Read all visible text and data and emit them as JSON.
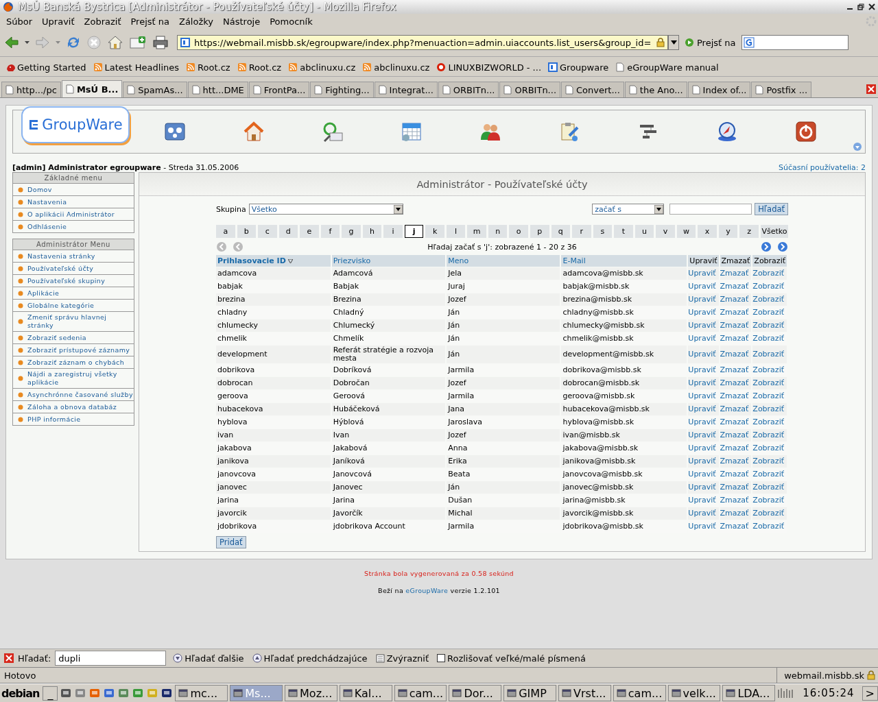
{
  "window": {
    "title": "MsÚ Banská Bystrica [Administrátor - Používateľské účty] - Mozilla Firefox"
  },
  "menu": [
    "Súbor",
    "Upraviť",
    "Zobraziť",
    "Prejsť na",
    "Záložky",
    "Nástroje",
    "Pomocník"
  ],
  "address": {
    "value": "https://webmail.misbb.sk/egroupware/index.php?menuaction=admin.uiaccounts.list_users&group_id=",
    "go": "Prejsť na"
  },
  "bookmarks": [
    {
      "label": "Getting Started",
      "kind": "page"
    },
    {
      "label": "Latest Headlines",
      "kind": "feed"
    },
    {
      "label": "Root.cz",
      "kind": "feed"
    },
    {
      "label": "Root.cz",
      "kind": "feed"
    },
    {
      "label": "abclinuxu.cz",
      "kind": "feed"
    },
    {
      "label": "abclinuxu.cz",
      "kind": "feed"
    },
    {
      "label": "LINUXBIZWORLD - ...",
      "kind": "ring"
    },
    {
      "label": "Groupware",
      "kind": "egw"
    },
    {
      "label": "eGroupWare manual",
      "kind": "doc"
    }
  ],
  "tabs": [
    {
      "label": "http.../pc",
      "selected": false
    },
    {
      "label": "MsÚ B...",
      "selected": true
    },
    {
      "label": "SpamAs...",
      "selected": false
    },
    {
      "label": "htt...DME",
      "selected": false
    },
    {
      "label": "FrontPa...",
      "selected": false
    },
    {
      "label": "Fighting...",
      "selected": false
    },
    {
      "label": "Integrat...",
      "selected": false
    },
    {
      "label": "ORBITn...",
      "selected": false
    },
    {
      "label": "ORBITn...",
      "selected": false
    },
    {
      "label": "Convert...",
      "selected": false
    },
    {
      "label": "the Ano...",
      "selected": false
    },
    {
      "label": "Index of...",
      "selected": false
    },
    {
      "label": "Postfix ...",
      "selected": false
    }
  ],
  "logo": "GroupWare",
  "user_line": {
    "user": "[admin] Administrator egroupware",
    "date": " - Streda 31.05.2006",
    "online": "Súčasní používatelia: 2"
  },
  "sidebar": [
    {
      "title": "Základné menu",
      "items": [
        "Domov",
        "Nastavenia",
        "O aplikácii Administrátor",
        "Odhlásenie"
      ]
    },
    {
      "title": "Administrátor Menu",
      "items": [
        "Nastavenia stránky",
        "Používateľské účty",
        "Používateľské skupiny",
        "Aplikácie",
        "Globálne kategórie",
        "Zmeniť správu hlavnej stránky",
        "Zobraziť sedenia",
        "Zobraziť prístupové záznamy",
        "Zobraziť záznam o chybách",
        "Nájdi a zaregistruj všetky aplikácie",
        "Asynchrónne časované služby",
        "Záloha a obnova databáz",
        "PHP informácie"
      ]
    }
  ],
  "panel_title": "Administrátor - Používateľské účty",
  "filter": {
    "group_label": "Skupina",
    "group_value": "Všetko",
    "mode_value": "začať s",
    "search_button": "Hľadať"
  },
  "letters": [
    {
      "label": "a",
      "selected": false
    },
    {
      "label": "b",
      "selected": false
    },
    {
      "label": "c",
      "selected": false
    },
    {
      "label": "d",
      "selected": false
    },
    {
      "label": "e",
      "selected": false
    },
    {
      "label": "f",
      "selected": false
    },
    {
      "label": "g",
      "selected": false
    },
    {
      "label": "h",
      "selected": false
    },
    {
      "label": "i",
      "selected": false
    },
    {
      "label": "j",
      "selected": true
    },
    {
      "label": "k",
      "selected": false
    },
    {
      "label": "l",
      "selected": false
    },
    {
      "label": "m",
      "selected": false
    },
    {
      "label": "n",
      "selected": false
    },
    {
      "label": "o",
      "selected": false
    },
    {
      "label": "p",
      "selected": false
    },
    {
      "label": "q",
      "selected": false
    },
    {
      "label": "r",
      "selected": false
    },
    {
      "label": "s",
      "selected": false
    },
    {
      "label": "t",
      "selected": false
    },
    {
      "label": "u",
      "selected": false
    },
    {
      "label": "v",
      "selected": false
    },
    {
      "label": "w",
      "selected": false
    },
    {
      "label": "x",
      "selected": false
    },
    {
      "label": "y",
      "selected": false
    },
    {
      "label": "z",
      "selected": false
    },
    {
      "label": "Všetko",
      "selected": false
    }
  ],
  "result_info": "Hľadaj začať s 'j': zobrazené 1 - 20 z 36",
  "table": {
    "columns": [
      {
        "label": "Prihlasovacie ID",
        "sorted": true,
        "kind": "link"
      },
      {
        "label": "Priezvisko",
        "sorted": false,
        "kind": "link"
      },
      {
        "label": "Meno",
        "sorted": false,
        "kind": "link"
      },
      {
        "label": "E-Mail",
        "sorted": false,
        "kind": "link"
      },
      {
        "label": "Upraviť",
        "sorted": false,
        "kind": "plain"
      },
      {
        "label": "Zmazať",
        "sorted": false,
        "kind": "plain"
      },
      {
        "label": "Zobraziť",
        "sorted": false,
        "kind": "plain"
      }
    ],
    "rows": [
      {
        "cells": [
          "adamcova",
          "Adamcová",
          "Jela",
          "adamcova@misbb.sk"
        ],
        "actions": [
          "Upraviť",
          "Zmazať",
          "Zobraziť"
        ]
      },
      {
        "cells": [
          "babjak",
          "Babjak",
          "Juraj",
          "babjak@misbb.sk"
        ],
        "actions": [
          "Upraviť",
          "Zmazať",
          "Zobraziť"
        ]
      },
      {
        "cells": [
          "brezina",
          "Brezina",
          "Jozef",
          "brezina@misbb.sk"
        ],
        "actions": [
          "Upraviť",
          "Zmazať",
          "Zobraziť"
        ]
      },
      {
        "cells": [
          "chladny",
          "Chladný",
          "Ján",
          "chladny@misbb.sk"
        ],
        "actions": [
          "Upraviť",
          "Zmazať",
          "Zobraziť"
        ]
      },
      {
        "cells": [
          "chlumecky",
          "Chlumecký",
          "Ján",
          "chlumecky@misbb.sk"
        ],
        "actions": [
          "Upraviť",
          "Zmazať",
          "Zobraziť"
        ]
      },
      {
        "cells": [
          "chmelik",
          "Chmelík",
          "Ján",
          "chmelik@misbb.sk"
        ],
        "actions": [
          "Upraviť",
          "Zmazať",
          "Zobraziť"
        ]
      },
      {
        "cells": [
          "development",
          "Referát stratégie a rozvoja mesta",
          "Ján",
          "development@misbb.sk"
        ],
        "actions": [
          "Upraviť",
          "Zmazať",
          "Zobraziť"
        ]
      },
      {
        "cells": [
          "dobrikova",
          "Dobríková",
          "Jarmila",
          "dobrikova@misbb.sk"
        ],
        "actions": [
          "Upraviť",
          "Zmazať",
          "Zobraziť"
        ]
      },
      {
        "cells": [
          "dobrocan",
          "Dobročan",
          "Jozef",
          "dobrocan@misbb.sk"
        ],
        "actions": [
          "Upraviť",
          "Zmazať",
          "Zobraziť"
        ]
      },
      {
        "cells": [
          "geroova",
          "Geroová",
          "Jarmila",
          "geroova@misbb.sk"
        ],
        "actions": [
          "Upraviť",
          "Zmazať",
          "Zobraziť"
        ]
      },
      {
        "cells": [
          "hubacekova",
          "Hubáčeková",
          "Jana",
          "hubacekova@misbb.sk"
        ],
        "actions": [
          "Upraviť",
          "Zmazať",
          "Zobraziť"
        ]
      },
      {
        "cells": [
          "hyblova",
          "Hýblová",
          "Jaroslava",
          "hyblova@misbb.sk"
        ],
        "actions": [
          "Upraviť",
          "Zmazať",
          "Zobraziť"
        ]
      },
      {
        "cells": [
          "ivan",
          "Ivan",
          "Jozef",
          "ivan@misbb.sk"
        ],
        "actions": [
          "Upraviť",
          "Zmazať",
          "Zobraziť"
        ]
      },
      {
        "cells": [
          "jakabova",
          "Jakabová",
          "Anna",
          "jakabova@misbb.sk"
        ],
        "actions": [
          "Upraviť",
          "Zmazať",
          "Zobraziť"
        ]
      },
      {
        "cells": [
          "janikova",
          "Janíková",
          "Erika",
          "janikova@misbb.sk"
        ],
        "actions": [
          "Upraviť",
          "Zmazať",
          "Zobraziť"
        ]
      },
      {
        "cells": [
          "janovcova",
          "Janovcová",
          "Beata",
          "janovcova@misbb.sk"
        ],
        "actions": [
          "Upraviť",
          "Zmazať",
          "Zobraziť"
        ]
      },
      {
        "cells": [
          "janovec",
          "Janovec",
          "Ján",
          "janovec@misbb.sk"
        ],
        "actions": [
          "Upraviť",
          "Zmazať",
          "Zobraziť"
        ]
      },
      {
        "cells": [
          "jarina",
          "Jarina",
          "Dušan",
          "jarina@misbb.sk"
        ],
        "actions": [
          "Upraviť",
          "Zmazať",
          "Zobraziť"
        ]
      },
      {
        "cells": [
          "javorcik",
          "Javorčík",
          "Michal",
          "javorcik@misbb.sk"
        ],
        "actions": [
          "Upraviť",
          "Zmazať",
          "Zobraziť"
        ]
      },
      {
        "cells": [
          "jdobrikova",
          "jdobrikova Account",
          "Jarmila",
          "jdobrikova@misbb.sk"
        ],
        "actions": [
          "Upraviť",
          "Zmazať",
          "Zobraziť"
        ]
      }
    ]
  },
  "add_button": "Pridať",
  "footer": {
    "generated": "Stránka bola vygenerovaná za 0.58 sekúnd",
    "runs_on": "Beží na ",
    "link": "eGroupWare",
    "version": " verzie 1.2.101"
  },
  "findbar": {
    "label": "Hľadať:",
    "value": "dupli",
    "next": "Hľadať ďalšie",
    "prev": "Hľadať predchádzajúce",
    "highlight": "Zvýrazniť",
    "match_case": "Rozlišovať veľké/malé písmená",
    "match_case_checked": false
  },
  "status": {
    "text": "Hotovo",
    "host": "webmail.misbb.sk"
  },
  "taskbar": {
    "start": "debian",
    "minimize": "_",
    "tasks": [
      {
        "label": "mc...",
        "selected": false
      },
      {
        "label": "Ms...",
        "selected": true
      },
      {
        "label": "Moz...",
        "selected": false
      },
      {
        "label": "Kal...",
        "selected": false
      },
      {
        "label": "cam...",
        "selected": false
      },
      {
        "label": "Dor...",
        "selected": false
      },
      {
        "label": "GIMP",
        "selected": false
      },
      {
        "label": "Vrst...",
        "selected": false
      },
      {
        "label": "cam...",
        "selected": false
      },
      {
        "label": "velk...",
        "selected": false
      },
      {
        "label": "LDA...",
        "selected": false
      }
    ],
    "clock": "16:05:24",
    "more": ">"
  }
}
